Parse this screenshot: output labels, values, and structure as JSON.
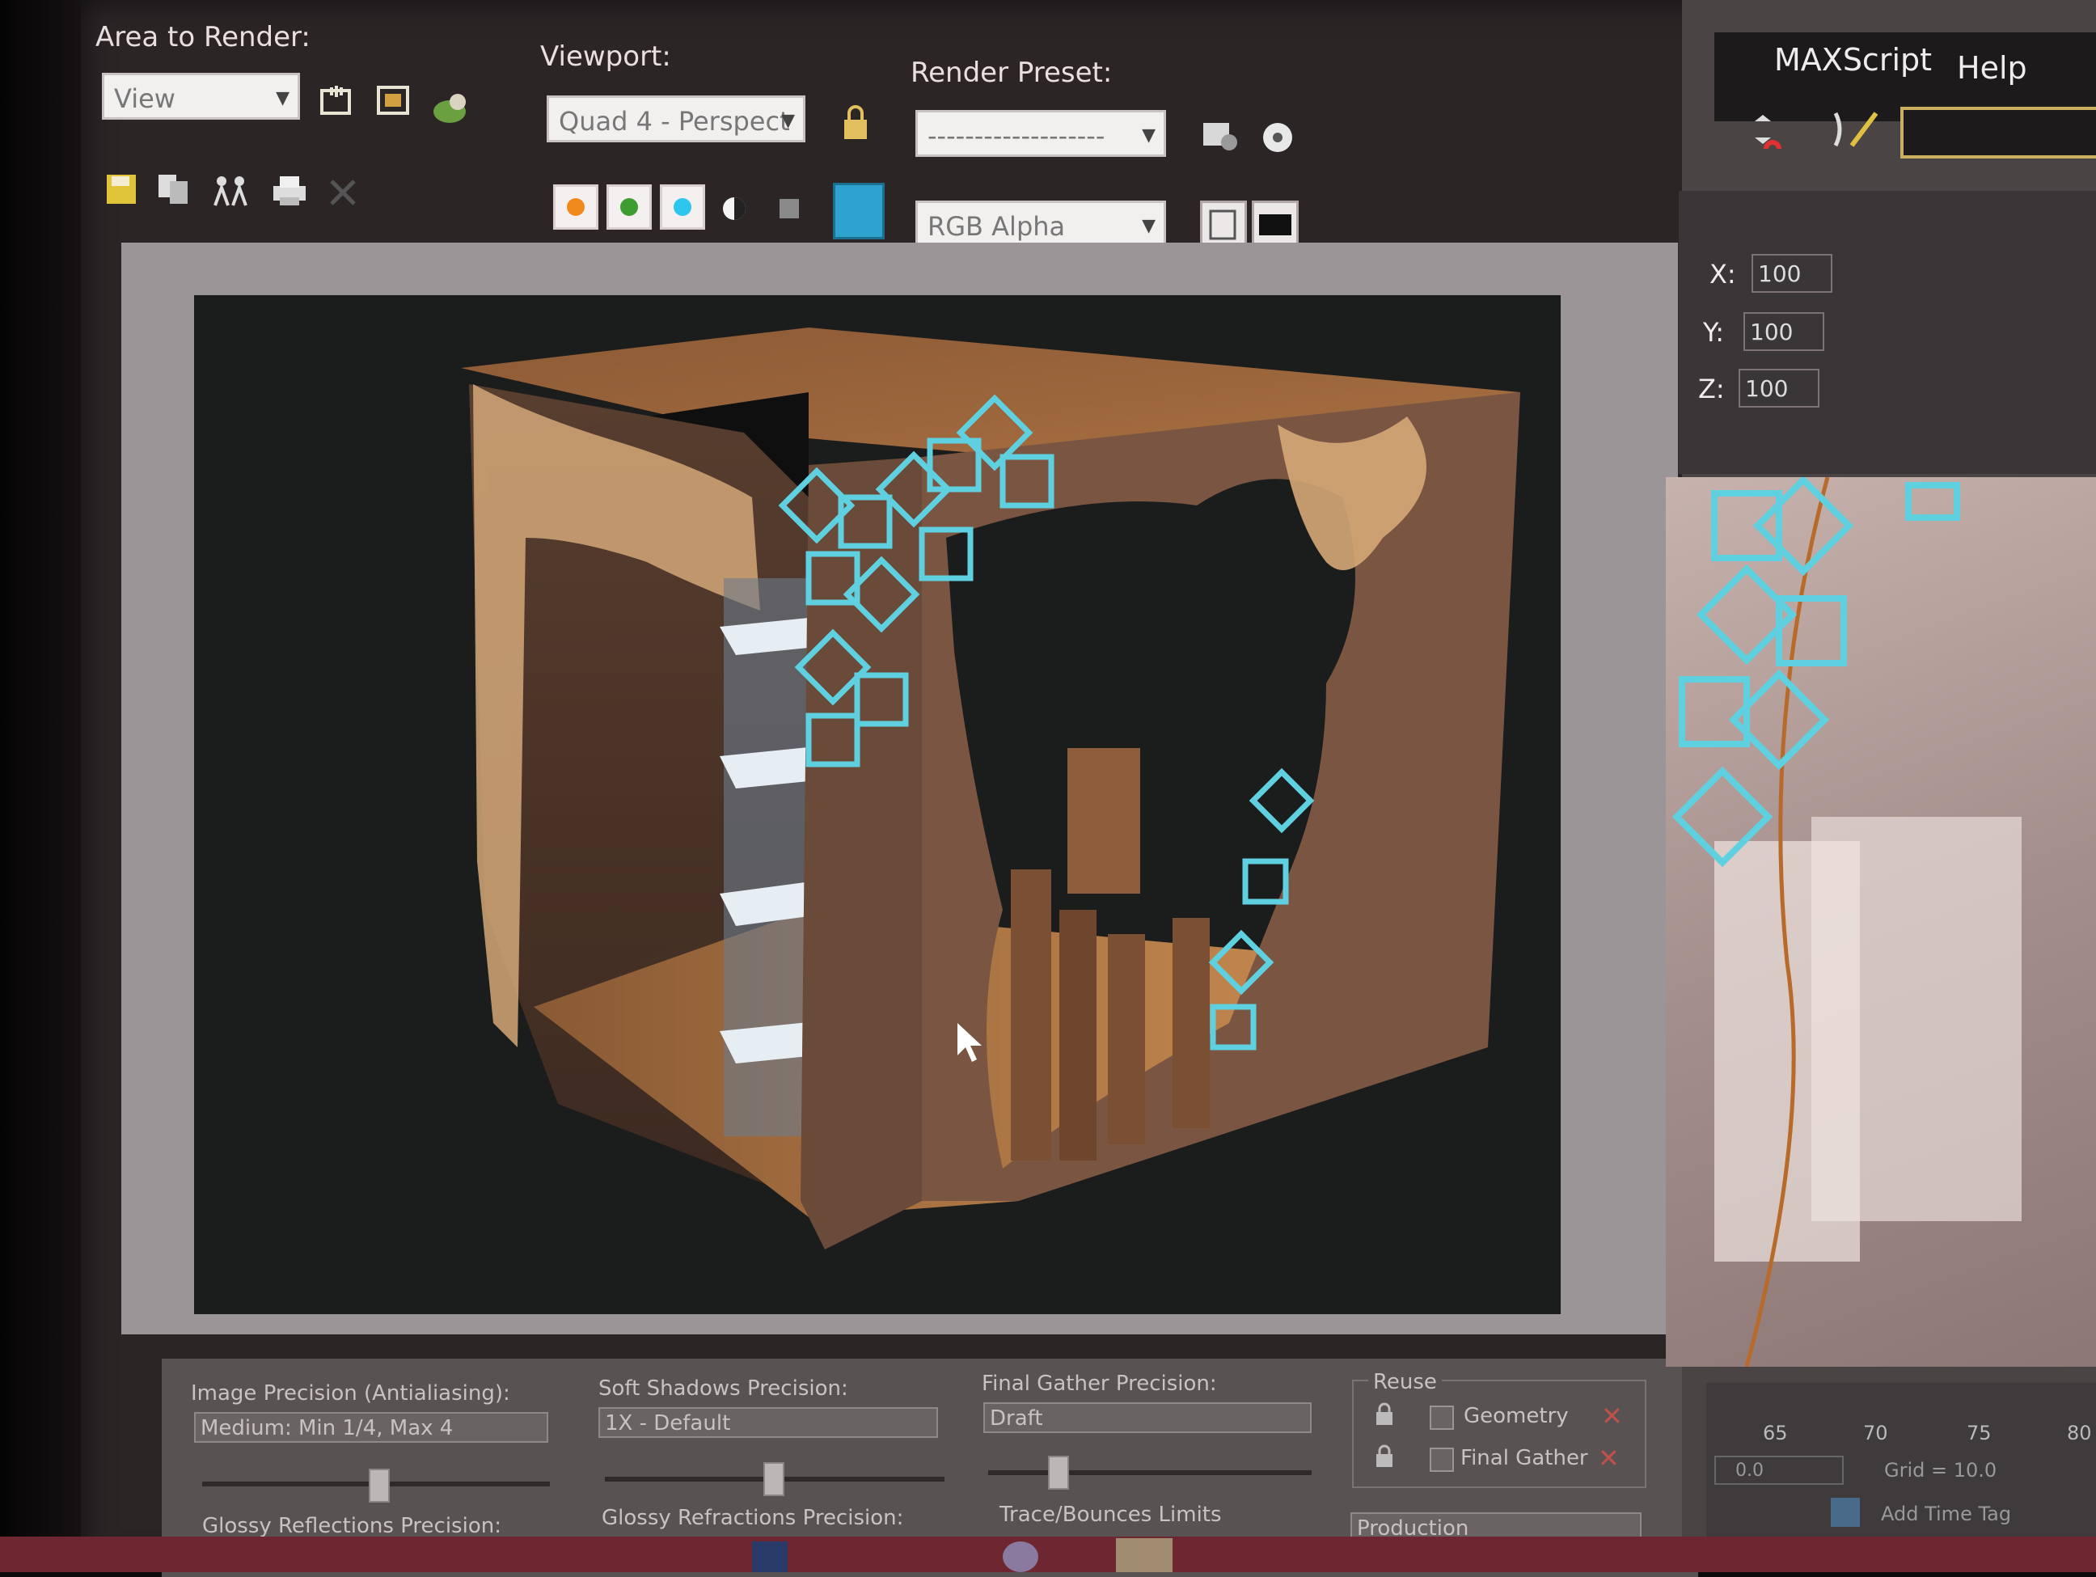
{
  "render_window": {
    "area_to_render_label": "Area to Render:",
    "area_to_render_value": "View",
    "viewport_label": "Viewport:",
    "viewport_value": "Quad 4 - Perspect",
    "render_preset_label": "Render Preset:",
    "render_preset_value": "-------------------",
    "channel_value": "RGB Alpha"
  },
  "bottom_panel": {
    "image_precision_label": "Image Precision (Antialiasing):",
    "image_precision_value": "Medium: Min 1/4, Max 4",
    "soft_shadows_label": "Soft Shadows Precision:",
    "soft_shadows_value": "1X - Default",
    "final_gather_label": "Final Gather Precision:",
    "final_gather_value": "Draft",
    "reuse_label": "Reuse",
    "reuse_geometry": "Geometry",
    "reuse_final_gather": "Final Gather",
    "glossy_reflections_label": "Glossy Reflections Precision:",
    "glossy_refractions_label": "Glossy Refractions Precision:",
    "trace_bounces_label": "Trace/Bounces Limits",
    "production_value": "Production"
  },
  "main_window": {
    "menu_maxscript": "MAXScript",
    "menu_help": "Help",
    "x_label": "X:",
    "x_value": "100",
    "y_label": "Y:",
    "y_value": "100",
    "z_label": "Z:",
    "z_value": "100",
    "timeline_ticks": [
      "65",
      "70",
      "75",
      "80"
    ],
    "grid_value": "Grid = 10.0",
    "add_time_tag": "Add Time Tag",
    "z_coord_value": "0.0"
  },
  "colors": {
    "accent_blue": "#2ea3d0",
    "ornament_cyan": "#5fd0e0",
    "wood": "#b0784a"
  }
}
